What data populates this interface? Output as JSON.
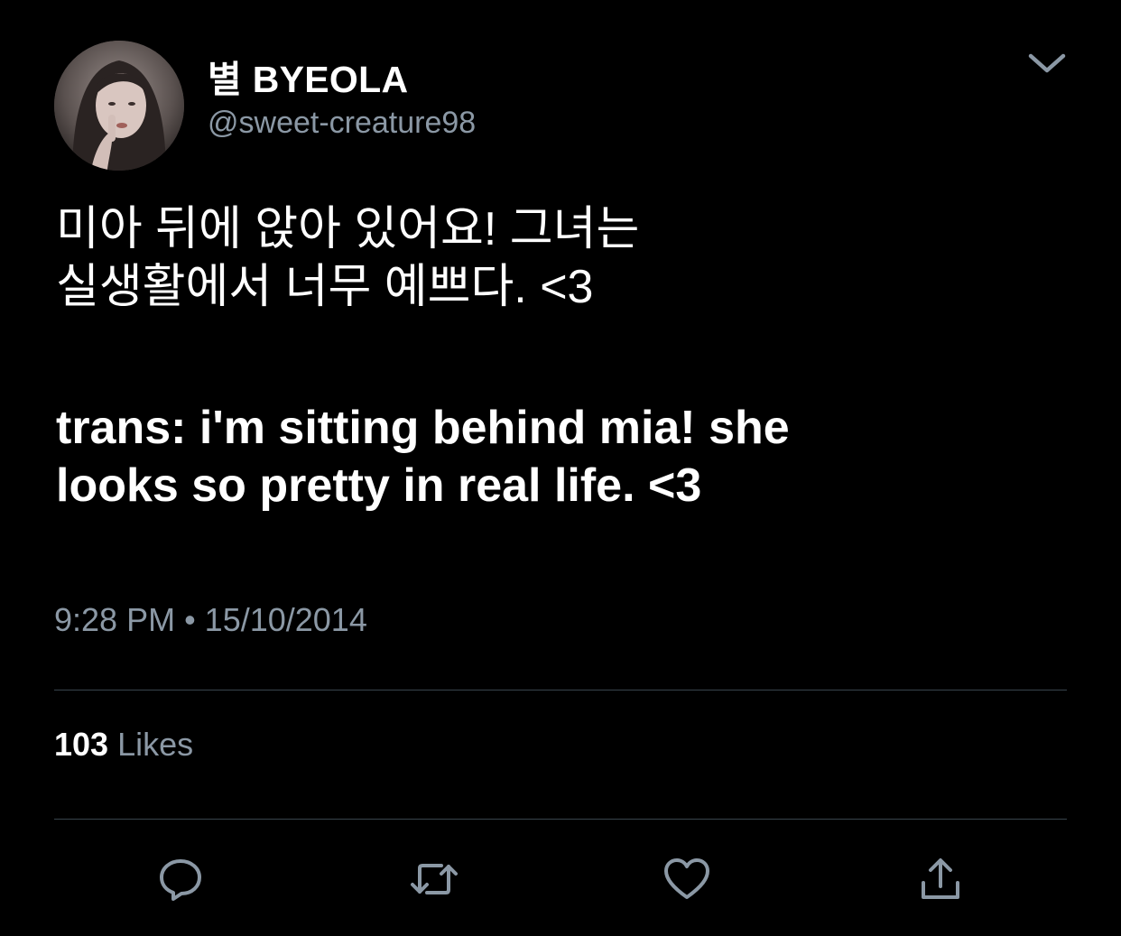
{
  "tweet": {
    "display_name": "별 BYEOLA",
    "handle": "@sweet-creature98",
    "text_korean_line1": "미아 뒤에 앉아 있어요! 그녀는",
    "text_korean_line2": "실생활에서 너무 예쁘다. <3",
    "text_trans_line1": "trans: i'm sitting behind mia! she",
    "text_trans_line2": "looks so pretty in real life. <3",
    "timestamp": "9:28 PM • 15/10/2014",
    "likes_count": "103",
    "likes_label": "Likes"
  },
  "icons": {
    "menu": "chevron-down-icon",
    "reply": "reply-icon",
    "retweet": "retweet-icon",
    "like": "heart-icon",
    "share": "share-icon"
  },
  "colors": {
    "background": "#000000",
    "primary_text": "#ffffff",
    "secondary_text": "#8b98a5",
    "divider": "#38444d",
    "icon": "#8b98a5"
  }
}
